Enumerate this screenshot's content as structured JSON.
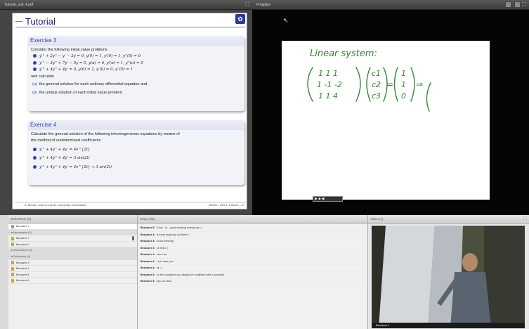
{
  "pdf": {
    "window_title": "Tutorial_unit_4.pdf",
    "slide_title": "Tutorial",
    "ex3": {
      "title": "Exercise 3",
      "intro": "Consider the following initial value problems",
      "equations": [
        "y''' + 2y'' − y' − 2y = 0,  y(0) = 1,  y'(0) = 1,  y''(0) = 0",
        "y''' − 3y'' + 7y' − 5y = 0,  y(π) = 6,  y'(π) = 1,  y''(π) = 0",
        "y''' + 4y'' + 4y' = 0,  y(0) = 2,  y'(0) = 0,  y''(0) = 1"
      ],
      "calc": "and calculate",
      "items": [
        {
          "label": "(a)",
          "text": "the general solution for each ordinary differential equation and"
        },
        {
          "label": "(b)",
          "text": "the unique solution of each initial value problem."
        }
      ]
    },
    "ex4": {
      "title": "Exercise 4",
      "intro1": "Calculate the general solution of the following inhomogeneous equations by means of",
      "intro2": "the method of undetermined coefficients",
      "equations": [
        "y''' + 4y'' + 4y' = 4e^{2t}",
        "y''' + 4y'' + 4y' = 3 sin(2t)",
        "y''' + 4y'' + 4y' = 4e^{2t} + 3 sin(2t)"
      ]
    },
    "footer_left": "A. Birkner, www.uni-lm.de, University of Konstanz",
    "footer_right": "MODE • Unit 4: Tutorial — 2"
  },
  "whiteboard": {
    "title": "Freigabe",
    "heading": "Linear system:",
    "matrix": [
      "1  1  1",
      "1 -1 -2",
      "1  1  4"
    ],
    "vars": [
      "c1",
      "c2",
      "c3"
    ],
    "rhs": [
      "1",
      "1",
      "0"
    ],
    "media_label": "▶ ■ ◀"
  },
  "participants": {
    "title": "Teilnehmer (6)",
    "rows": [
      {
        "type": "user",
        "name": "Benutzer 1",
        "selected": true
      },
      {
        "type": "group",
        "name": "▾ Veranstalter (2)"
      },
      {
        "type": "user",
        "name": "Benutzer 1",
        "mic": true
      },
      {
        "type": "user",
        "name": "Benutzer 2"
      },
      {
        "type": "group",
        "name": "▸ Moderatoren (0)"
      },
      {
        "type": "group",
        "name": "▾ Teilnehmer (4)"
      },
      {
        "type": "user",
        "name": "Benutzer 3"
      },
      {
        "type": "user",
        "name": "Benutzer 4"
      },
      {
        "type": "user",
        "name": "Benutzer 5"
      },
      {
        "type": "user",
        "name": "Benutzer 6"
      }
    ]
  },
  "chat": {
    "title": "Chat (Alle)",
    "messages": [
      {
        "user": "Benutzer 5:",
        "text": "O-bsi...ih... good evening everybody :)"
      },
      {
        "user": "Benutzer 3:",
        "text": "is there anybody out there ?"
      },
      {
        "user": "Benutzer 3:",
        "text": "Good evening!"
      },
      {
        "user": "Benutzer 3:",
        "text": "oh hello :)"
      },
      {
        "user": "Benutzer 1:",
        "text": "now I do"
      },
      {
        "user": "Benutzer 4:",
        "text": "I can hear you"
      },
      {
        "user": "Benutzer 4:",
        "text": "ok :)"
      },
      {
        "user": "Benutzer 3:",
        "text": "so the constants can always be multiplied with a constant"
      },
      {
        "user": "Benutzer 3:",
        "text": "yep, all clear"
      }
    ]
  },
  "video": {
    "title": "Video (1)",
    "name": "Benutzer 1"
  }
}
